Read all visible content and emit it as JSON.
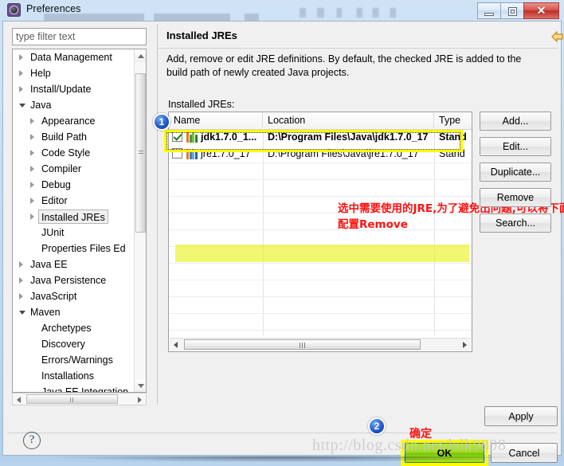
{
  "window": {
    "title": "Preferences",
    "icon": "preferences-gear-icon",
    "controls": {
      "minimize": "minimize-button",
      "maximize": "restore-button",
      "close": "✕"
    }
  },
  "sidebar": {
    "filter": {
      "placeholder": "type filter text",
      "value": ""
    },
    "items": [
      {
        "label": "Data Management",
        "indent": 0,
        "state": "collapsed"
      },
      {
        "label": "Help",
        "indent": 0,
        "state": "collapsed"
      },
      {
        "label": "Install/Update",
        "indent": 0,
        "state": "collapsed"
      },
      {
        "label": "Java",
        "indent": 0,
        "state": "expanded"
      },
      {
        "label": "Appearance",
        "indent": 1,
        "state": "collapsed"
      },
      {
        "label": "Build Path",
        "indent": 1,
        "state": "collapsed"
      },
      {
        "label": "Code Style",
        "indent": 1,
        "state": "collapsed"
      },
      {
        "label": "Compiler",
        "indent": 1,
        "state": "collapsed"
      },
      {
        "label": "Debug",
        "indent": 1,
        "state": "collapsed"
      },
      {
        "label": "Editor",
        "indent": 1,
        "state": "collapsed"
      },
      {
        "label": "Installed JREs",
        "indent": 1,
        "state": "collapsed",
        "selected": true
      },
      {
        "label": "JUnit",
        "indent": 1,
        "state": "leaf"
      },
      {
        "label": "Properties Files Ed",
        "indent": 1,
        "state": "leaf"
      },
      {
        "label": "Java EE",
        "indent": 0,
        "state": "collapsed"
      },
      {
        "label": "Java Persistence",
        "indent": 0,
        "state": "collapsed"
      },
      {
        "label": "JavaScript",
        "indent": 0,
        "state": "collapsed"
      },
      {
        "label": "Maven",
        "indent": 0,
        "state": "expanded"
      },
      {
        "label": "Archetypes",
        "indent": 1,
        "state": "leaf"
      },
      {
        "label": "Discovery",
        "indent": 1,
        "state": "leaf"
      },
      {
        "label": "Errors/Warnings",
        "indent": 1,
        "state": "leaf"
      },
      {
        "label": "Installations",
        "indent": 1,
        "state": "leaf"
      },
      {
        "label": "Java EE Integration",
        "indent": 1,
        "state": "leaf"
      }
    ]
  },
  "page": {
    "title": "Installed JREs",
    "description": "Add, remove or edit JRE definitions. By default, the checked JRE is added to the build path of newly created Java projects.",
    "table_label": "Installed JREs:",
    "nav": {
      "back": "back-arrow",
      "back_menu": "back-dropdown",
      "forward": "forward-arrow",
      "forward_menu": "forward-dropdown",
      "view_menu": "view-menu"
    }
  },
  "table": {
    "columns": [
      "Name",
      "Location",
      "Type"
    ],
    "rows": [
      {
        "checked": true,
        "name": "jdk1.7.0_1...",
        "location": "D:\\Program Files\\Java\\jdk1.7.0_17",
        "type": "Stand",
        "selected": true
      },
      {
        "checked": false,
        "name": "jre1.7.0_17",
        "location": "D:\\Program Files\\Java\\jre1.7.0_17",
        "type": "Stand",
        "selected": false
      }
    ]
  },
  "side_buttons": [
    {
      "label": "Add...",
      "name": "add-button"
    },
    {
      "label": "Edit...",
      "name": "edit-button"
    },
    {
      "label": "Duplicate...",
      "name": "duplicate-button"
    },
    {
      "label": "Remove",
      "name": "remove-button"
    },
    {
      "label": "Search...",
      "name": "search-button"
    }
  ],
  "footer": {
    "help": "?",
    "apply": "Apply",
    "ok": "OK",
    "cancel": "Cancel"
  },
  "annotations": {
    "badge1": "1",
    "badge2": "2",
    "note_table": "选中需要使用的JRE,为了避免出问题,可以将下面一条配置Remove",
    "note_ok": "确定",
    "watermark": "http://blog.csdn.net/lslk9898",
    "highlight_color": "#fffa00"
  }
}
